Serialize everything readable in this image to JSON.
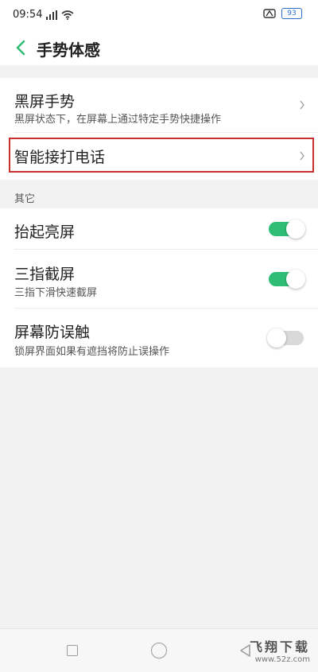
{
  "status_bar": {
    "time": "09:54",
    "battery": "93"
  },
  "header": {
    "title": "手势体感"
  },
  "gestures": {
    "black_screen": {
      "title": "黑屏手势",
      "subtitle": "黑屏状态下，在屏幕上通过特定手势快捷操作"
    },
    "smart_call": {
      "title": "智能接打电话"
    }
  },
  "others": {
    "section_label": "其它",
    "raise_wake": {
      "title": "抬起亮屏",
      "enabled": true
    },
    "three_finger": {
      "title": "三指截屏",
      "subtitle": "三指下滑快速截屏",
      "enabled": true
    },
    "anti_touch": {
      "title": "屏幕防误触",
      "subtitle": "锁屏界面如果有遮挡将防止误操作",
      "enabled": false
    }
  },
  "colors": {
    "accent": "#2fbd76",
    "highlight_border": "#c9302c"
  },
  "icons": [
    "back-arrow-icon",
    "signal-icon",
    "wifi-icon",
    "battery-icon",
    "chevron-right-icon",
    "recents-icon",
    "home-icon",
    "back-icon"
  ],
  "watermark": {
    "brand": "飞翔下载",
    "url": "www.52z.com"
  }
}
